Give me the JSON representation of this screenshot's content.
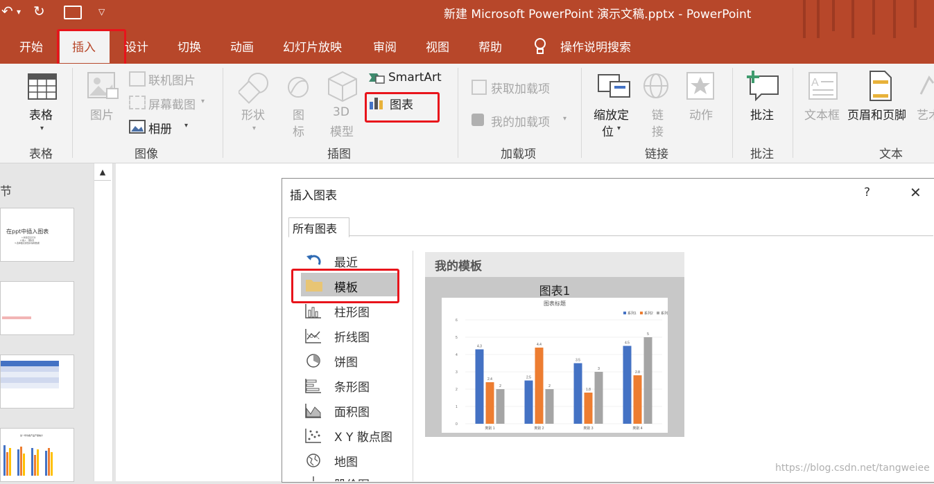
{
  "window": {
    "title": "新建 Microsoft PowerPoint 演示文稿.pptx  -  PowerPoint"
  },
  "tabs": [
    "开始",
    "插入",
    "设计",
    "切换",
    "动画",
    "幻灯片放映",
    "审阅",
    "视图",
    "帮助"
  ],
  "tell_me": "操作说明搜索",
  "ribbon": {
    "table_btn": "表格",
    "groups": [
      "表格",
      "图像",
      "插图",
      "加载项",
      "链接",
      "批注",
      "文本"
    ],
    "image_btn": "图片",
    "online_pic": "联机图片",
    "screenshot": "屏幕截图",
    "album": "相册",
    "shapes": "形状",
    "icons_l1": "图",
    "icons_l2": "标",
    "model_l1": "3D",
    "model_l2": "模型",
    "smartart": "SmartArt",
    "chart": "图表",
    "get_addins": "获取加载项",
    "my_addins": "我的加载项",
    "zoom_l1": "缩放定",
    "zoom_l2": "位",
    "link_l1": "链",
    "link_l2": "接",
    "action": "动作",
    "comment": "批注",
    "textbox": "文本框",
    "header_footer": "页眉和页脚",
    "wordart": "艺术"
  },
  "slides_panel": {
    "section": "节",
    "slide1_title": "在ppt中插入图表",
    "slide1_lines": [
      "1.新建空幻灯片",
      "2.插入 【图表】",
      "3.选择图表类型并编辑数据"
    ],
    "slide4_title": "某一年份各产品产量统计"
  },
  "dialog": {
    "title": "插入图表",
    "help": "?",
    "close": "✕",
    "tab": "所有图表",
    "categories": [
      "最近",
      "模板",
      "柱形图",
      "折线图",
      "饼图",
      "条形图",
      "面积图",
      "X Y 散点图",
      "地图",
      "股价图"
    ],
    "template_header": "我的模板",
    "template_name": "图表1"
  },
  "chart_data": {
    "type": "bar",
    "title": "图表标题",
    "categories": [
      "类别 1",
      "类别 2",
      "类别 3",
      "类别 4"
    ],
    "series": [
      {
        "name": "系列1",
        "values": [
          4.3,
          2.5,
          3.5,
          4.5
        ],
        "color": "#4472c4"
      },
      {
        "name": "系列2",
        "values": [
          2.4,
          4.4,
          1.8,
          2.8
        ],
        "color": "#ed7d31"
      },
      {
        "name": "系列3",
        "values": [
          2,
          2,
          3,
          5
        ],
        "color": "#a5a5a5"
      }
    ],
    "ylim": [
      0,
      6
    ],
    "yticks": [
      "0",
      "1",
      "2",
      "3",
      "4",
      "5",
      "6"
    ],
    "legend": "top-right",
    "data_labels": true
  },
  "watermark": "https://blog.csdn.net/tangweiee"
}
